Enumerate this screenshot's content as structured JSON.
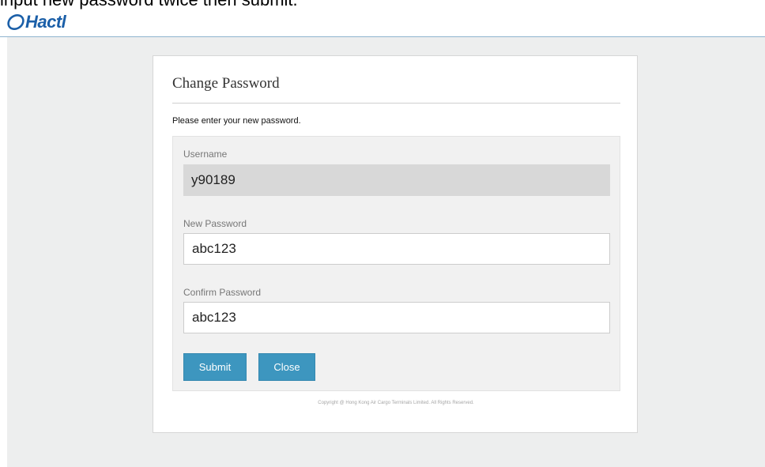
{
  "instruction": "input new password twice then submit.",
  "header": {
    "logo_text": "Hactl",
    "logo_icon": "hactl-swoosh-logo",
    "brand_color": "#1b5fa8"
  },
  "form": {
    "title": "Change Password",
    "intro": "Please enter your new password.",
    "username": {
      "label": "Username",
      "value": "y90189"
    },
    "new_password": {
      "label": "New Password",
      "value": "abc123"
    },
    "confirm_password": {
      "label": "Confirm Password",
      "value": "abc123"
    },
    "submit_label": "Submit",
    "close_label": "Close",
    "button_color": "#3d96bf"
  },
  "footer": {
    "copyright": "Copyright @ Hong Kong Air Cargo Terminals Limited. All Rights Reserved."
  }
}
